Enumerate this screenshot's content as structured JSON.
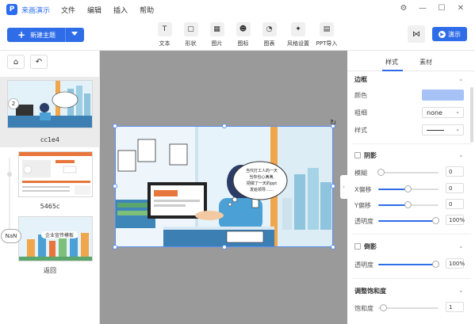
{
  "app": {
    "name": "来画演示",
    "logo_letter": "P"
  },
  "menu": [
    "文件",
    "编辑",
    "插入",
    "帮助"
  ],
  "window_controls": {
    "settings": "⚙",
    "minimize": "—",
    "maximize": "☐",
    "close": "✕"
  },
  "toolbar": {
    "add_theme_label": "新建主题",
    "tools": [
      {
        "icon": "text-icon",
        "glyph": "T",
        "label": "文本"
      },
      {
        "icon": "shape-icon",
        "glyph": "▢",
        "label": "形状"
      },
      {
        "icon": "image-icon",
        "glyph": "▦",
        "label": "图片"
      },
      {
        "icon": "emoji-icon",
        "glyph": "☻",
        "label": "图标"
      },
      {
        "icon": "chart-icon",
        "glyph": "◔",
        "label": "图表"
      },
      {
        "icon": "style-icon",
        "glyph": "✦",
        "label": "风格设置"
      },
      {
        "icon": "ppt-import-icon",
        "glyph": "▤",
        "label": "PPT导入"
      }
    ],
    "present_label": "演示"
  },
  "slides": [
    {
      "label": "cc1e4",
      "number": "2",
      "selected": true
    },
    {
      "label": "5465c"
    },
    {
      "label": "返回",
      "badge": "NaN",
      "caption": "企业宣传模板"
    }
  ],
  "canvas": {
    "bubble_text": "当代打工人的一天\n当你也心满满,\n把做了一天的ppt\n发给领导……"
  },
  "panel": {
    "tabs": [
      "样式",
      "素材"
    ],
    "border": {
      "title": "边框",
      "color_label": "颜色",
      "color": "#a7c2f7",
      "weight_label": "粗细",
      "weight_value": "none",
      "style_label": "样式"
    },
    "shadow": {
      "title": "阴影",
      "rows": [
        {
          "label": "模糊",
          "value": "0",
          "fraction": 0.0
        },
        {
          "label": "X偏移",
          "value": "0",
          "fraction": 0.5
        },
        {
          "label": "Y偏移",
          "value": "0",
          "fraction": 0.5
        },
        {
          "label": "透明度",
          "value": "100%",
          "fraction": 1.0
        }
      ]
    },
    "reflection": {
      "title": "倒影",
      "rows": [
        {
          "label": "透明度",
          "value": "100%",
          "fraction": 1.0
        }
      ]
    },
    "saturation": {
      "title": "调整饱和度",
      "rows": [
        {
          "label": "饱和度",
          "value": "1",
          "fraction": 0.0
        }
      ]
    }
  }
}
